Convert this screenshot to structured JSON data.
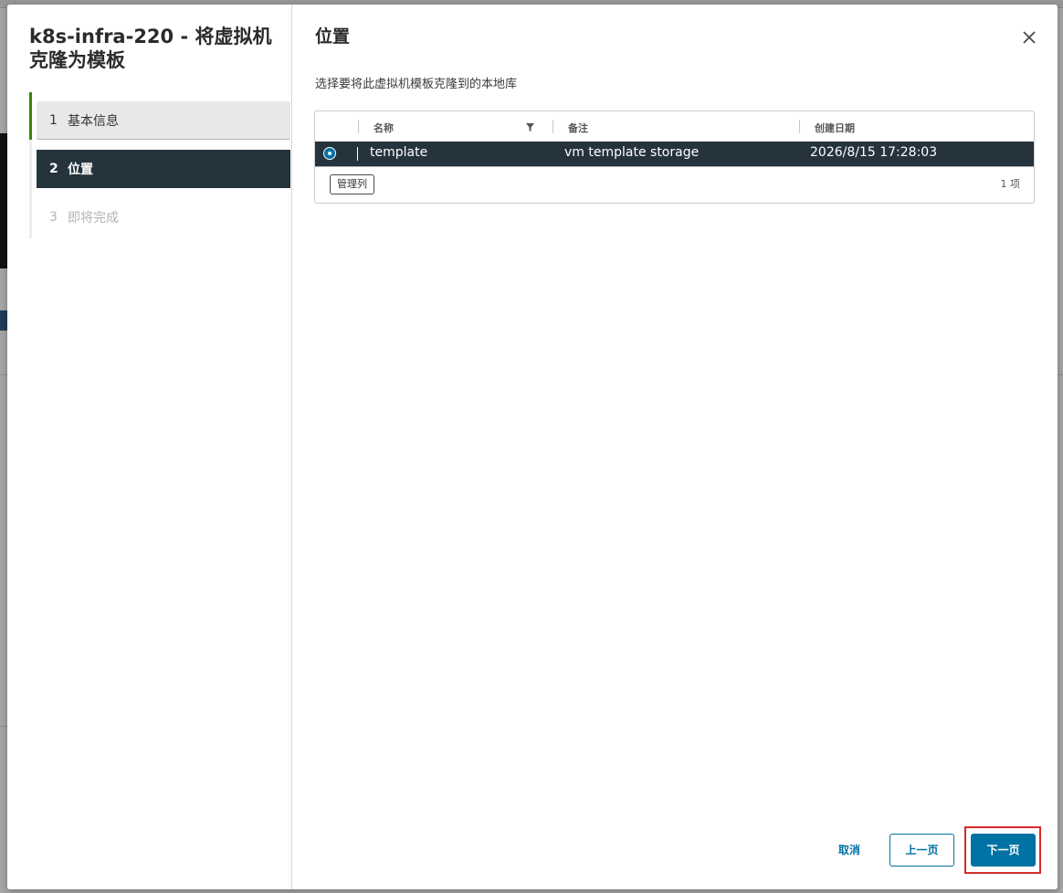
{
  "wizard": {
    "title": "k8s-infra-220 - 将虚拟机克隆为模板",
    "steps": [
      {
        "num": "1",
        "label": "基本信息",
        "state": "completed"
      },
      {
        "num": "2",
        "label": "位置",
        "state": "current"
      },
      {
        "num": "3",
        "label": "即将完成",
        "state": "disabled"
      }
    ]
  },
  "page": {
    "title": "位置",
    "instruction": "选择要将此虚拟机模板克隆到的本地库"
  },
  "grid": {
    "columns": {
      "name": "名称",
      "notes": "备注",
      "created": "创建日期"
    },
    "rows": [
      {
        "selected": true,
        "name": "template",
        "notes": "vm template storage",
        "created": "2026/8/15 17:28:03"
      }
    ],
    "manage_columns_label": "管理列",
    "item_count": "1 项"
  },
  "footer": {
    "cancel_label": "取消",
    "prev_label": "上一页",
    "next_label": "下一页"
  },
  "colors": {
    "accent": "#0072a3",
    "header_dark": "#25333d",
    "completed_step": "#3c8500",
    "highlight": "#d62b2b"
  },
  "icons": {
    "close": "close-icon",
    "filter": "filter-icon",
    "radio": "radio-selected-icon"
  }
}
